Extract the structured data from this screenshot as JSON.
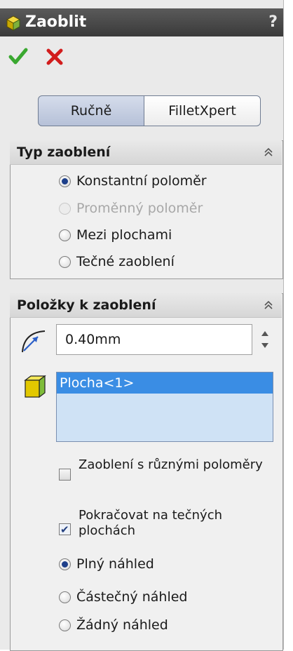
{
  "title": "Zaoblit",
  "help": "?",
  "modes": {
    "manual": "Ručně",
    "filletxpert": "FilletXpert"
  },
  "type_section": {
    "title": "Typ zaoblení",
    "options": [
      "Konstantní poloměr",
      "Proměnný poloměr",
      "Mezi plochami",
      "Tečné zaoblení"
    ]
  },
  "items_section": {
    "title": "Položky k zaoblení",
    "radius_value": "0.40mm",
    "selected_item": "Plocha<1>",
    "checkbox_multi_radius": "Zaoblení s různými poloměry",
    "checkbox_tangent": "Pokračovat na tečných plochách",
    "preview_options": [
      "Plný náhled",
      "Částečný náhled",
      "Žádný náhled"
    ]
  },
  "colors": {
    "titlebar": "#3f3f3f",
    "accept": "#3aa830",
    "cancel": "#d21d1d",
    "selection": "#3a8de4"
  },
  "icons": [
    "fillet-icon",
    "accept-icon",
    "cancel-icon",
    "collapse-icon",
    "radius-icon",
    "face-icon"
  ]
}
